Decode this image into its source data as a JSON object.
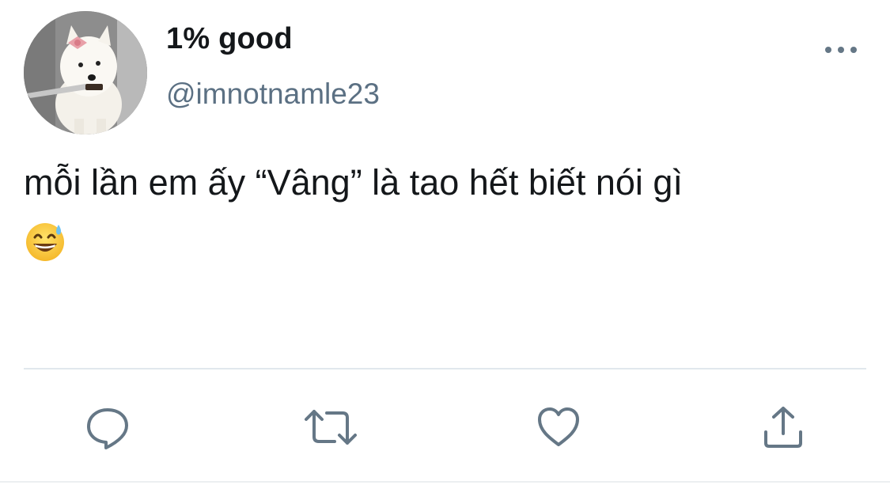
{
  "author": {
    "display_name": "1% good",
    "handle": "@imnotnamle23",
    "avatar_description": "white-dog-avatar"
  },
  "tweet": {
    "text": "mỗi lần em ấy “Vâng” là tao hết biết nói gì",
    "emoji": "grinning-face-with-sweat"
  },
  "actions": {
    "reply_icon": "reply-icon",
    "retweet_icon": "retweet-icon",
    "like_icon": "heart-icon",
    "share_icon": "share-icon",
    "more_icon": "more-icon"
  },
  "colors": {
    "text": "#14171a",
    "secondary": "#5b7083",
    "icon": "#657786",
    "divider": "#e1e8ed"
  }
}
